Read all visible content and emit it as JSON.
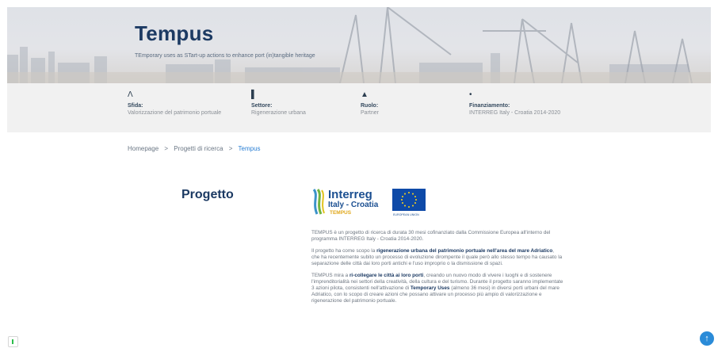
{
  "hero": {
    "title": "Tempus",
    "subtitle": "TEmporary uses as STart-up actions to enhance port (in)tangible heritage"
  },
  "info": [
    {
      "icon": "challenge-icon",
      "glyph": "Λ",
      "label": "Sfida:",
      "value": "Valorizzazione del patrimonio portuale"
    },
    {
      "icon": "sector-icon",
      "glyph": "▌",
      "label": "Settore:",
      "value": "Rigenerazione urbana"
    },
    {
      "icon": "person-icon",
      "glyph": "▲",
      "label": "Ruolo:",
      "value": "Partner"
    },
    {
      "icon": "funding-icon",
      "glyph": "•",
      "label": "Finanziamento:",
      "value": "INTERREG Italy - Croatia 2014-2020"
    }
  ],
  "breadcrumb": {
    "home": "Homepage",
    "sep1": ">",
    "research": "Progetti di ricerca",
    "sep2": ">",
    "current": "Tempus"
  },
  "section_title": "Progetto",
  "logo": {
    "line1": "Interreg",
    "line2": "Italy - Croatia",
    "line3": "TEMPUS",
    "eu": "EUROPEAN UNION"
  },
  "paragraphs": {
    "p1": "TEMPUS è un progetto di ricerca di durata 30 mesi cofinanziato dalla Commissione Europea all'interno del programma INTERREG Italy - Croatia 2014-2020.",
    "p2a": "Il progetto ha come scopo la ",
    "p2b": "rigenerazione urbana del patrimonio portuale nell'area del mare Adriatico",
    "p2c": ", che ha recentemente subito un processo di evoluzione dirompente il quale però allo stesso tempo ha causato la separazione delle città dai loro porti antichi e l'uso improprio o la dismissione di spazi.",
    "p3a": "TEMPUS mira a ",
    "p3b": "ri-collegare le città ai loro porti",
    "p3c": ", creando un nuovo modo di vivere i luoghi e di sostenere l'imprenditorialità nei settori della creatività, della cultura e del turismo. Durante il progetto saranno implementate 3 azioni pilota, consistenti nell'attivazione di ",
    "p3d": "Temporary Uses",
    "p3e": " (almeno 36 mesi) in diversi porti urbani del mare Adriatico, con lo scopo di creare azioni che possano attivare un processo più ampio di valorizzazione e rigenerazione del patrimonio portuale."
  },
  "colors": {
    "navy": "#1c3a63",
    "accent": "#2a7fd4",
    "infobar": "#f1f1f1"
  },
  "buttons": {
    "up": "↑"
  }
}
